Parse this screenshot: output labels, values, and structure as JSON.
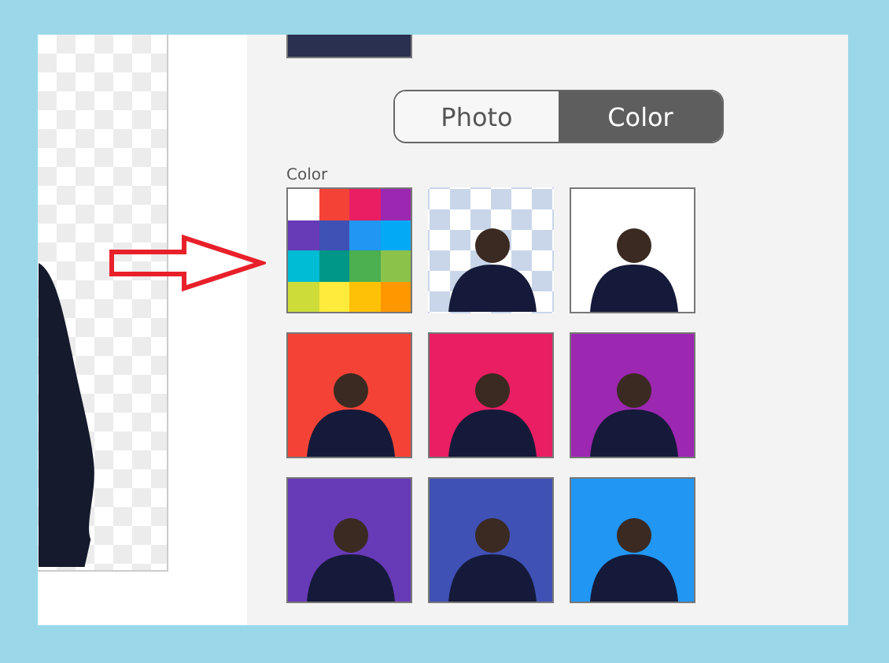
{
  "mode_toggle": [
    {
      "label": "Photo",
      "selected": false
    },
    {
      "label": "Color",
      "selected": true
    }
  ],
  "section_label": "Color",
  "tiles": [
    {
      "kind": "palette"
    },
    {
      "kind": "transparent"
    },
    {
      "kind": "color",
      "color": "#ffffff"
    },
    {
      "kind": "color",
      "color": "#f44336"
    },
    {
      "kind": "color",
      "color": "#e91e63"
    },
    {
      "kind": "color",
      "color": "#9c27b0"
    },
    {
      "kind": "color",
      "color": "#673ab7"
    },
    {
      "kind": "color",
      "color": "#3f51b5"
    },
    {
      "kind": "color",
      "color": "#2196f3"
    }
  ]
}
